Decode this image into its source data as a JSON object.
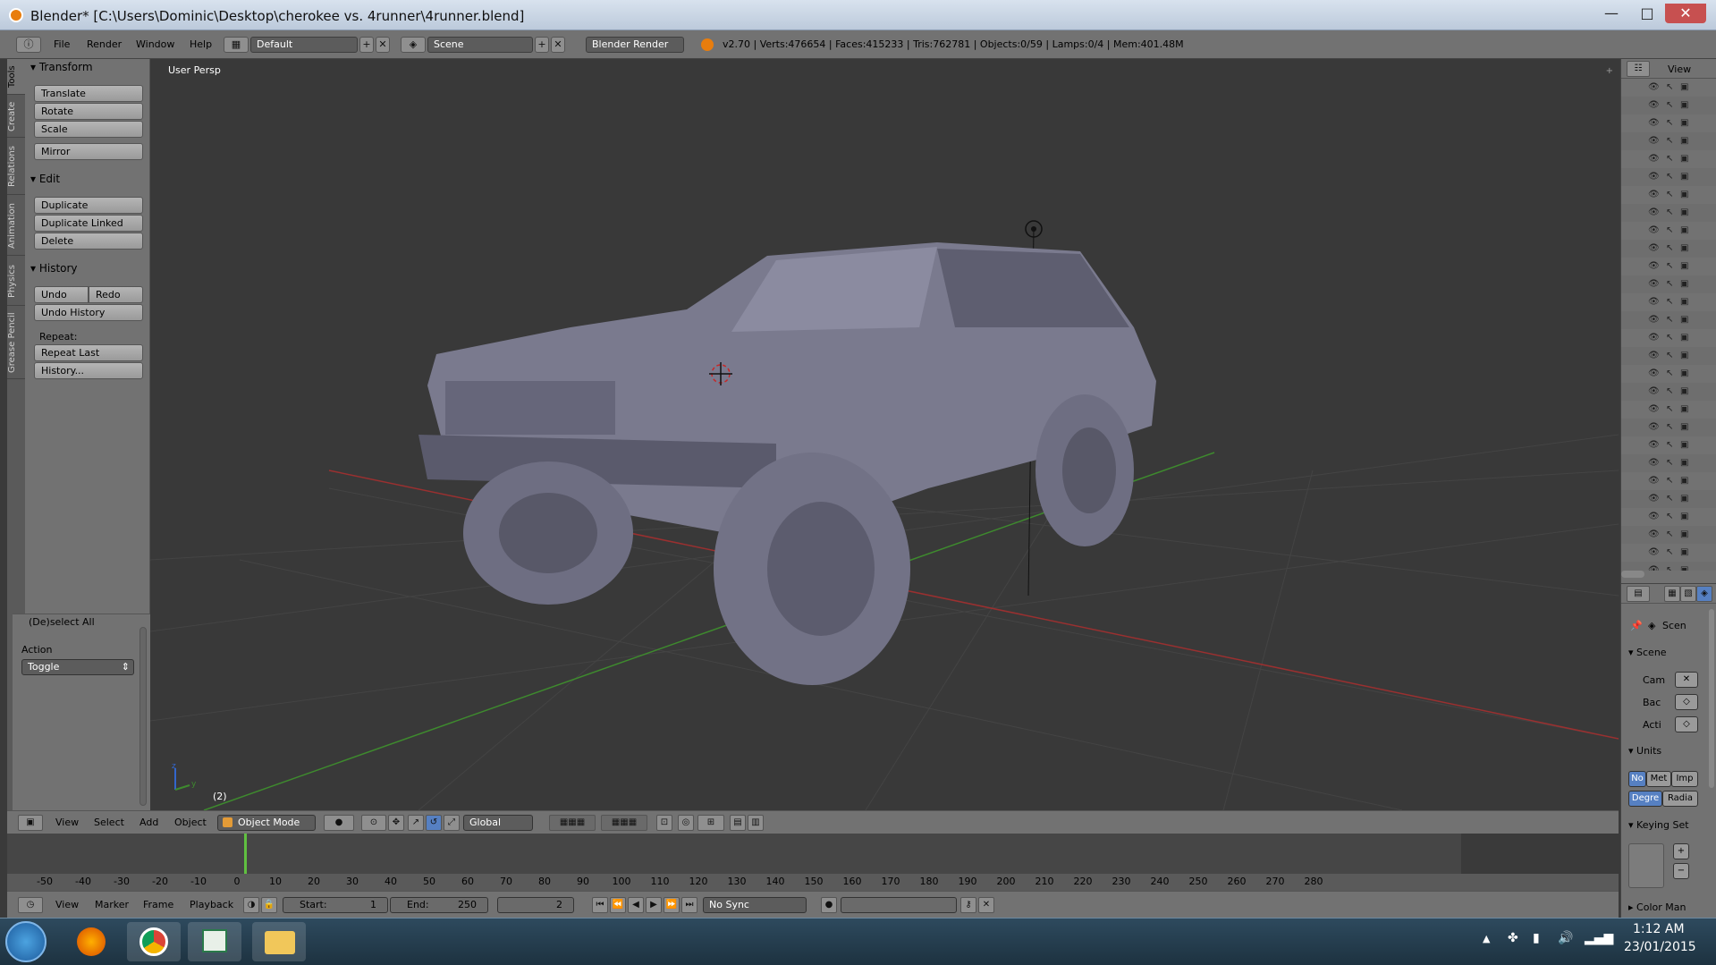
{
  "window": {
    "title": "Blender* [C:\\Users\\Dominic\\Desktop\\cherokee vs. 4runner\\4runner.blend]",
    "minimize": "—",
    "maximize": "□",
    "close": "✕"
  },
  "infobar": {
    "menus": [
      "File",
      "Render",
      "Window",
      "Help"
    ],
    "layout": "Default",
    "scene": "Scene",
    "engine": "Blender Render",
    "stats": "v2.70 | Verts:476654 | Faces:415233 | Tris:762781 | Objects:0/59 | Lamps:0/4 | Mem:401.48M"
  },
  "left_tabs": [
    "Tools",
    "Create",
    "Relations",
    "Animation",
    "Physics",
    "Grease Pencil"
  ],
  "toolshelf": {
    "transform": {
      "header": "Transform",
      "buttons": [
        "Translate",
        "Rotate",
        "Scale",
        "Mirror"
      ]
    },
    "edit": {
      "header": "Edit",
      "buttons": [
        "Duplicate",
        "Duplicate Linked",
        "Delete"
      ]
    },
    "history": {
      "header": "History",
      "undo": "Undo",
      "redo": "Redo",
      "undo_history": "Undo History",
      "repeat_label": "Repeat:",
      "repeat_last": "Repeat Last",
      "history": "History..."
    },
    "operator": {
      "header": "(De)select All",
      "action_label": "Action",
      "action_value": "Toggle"
    }
  },
  "viewport": {
    "label": "User Persp",
    "frame_indicator": "(2)",
    "axis_z": "z",
    "axis_y": "y"
  },
  "view_header": {
    "menus": [
      "View",
      "Select",
      "Add",
      "Object"
    ],
    "mode": "Object Mode",
    "orientation": "Global"
  },
  "timeline": {
    "ticks": [
      -50,
      -40,
      -30,
      -20,
      -10,
      0,
      10,
      20,
      30,
      40,
      50,
      60,
      70,
      80,
      90,
      100,
      110,
      120,
      130,
      140,
      150,
      160,
      170,
      180,
      190,
      200,
      210,
      220,
      230,
      240,
      250,
      260,
      270,
      280
    ],
    "current_frame_value": 2,
    "end_frame_value": 250
  },
  "timeline_header": {
    "menus": [
      "View",
      "Marker",
      "Frame",
      "Playback"
    ],
    "start": "Start:",
    "start_value": "1",
    "end": "End:",
    "end_value": "250",
    "current": "2",
    "sync": "No Sync"
  },
  "outliner": {
    "header": "View",
    "rows": 28
  },
  "properties": {
    "context": "Scen",
    "scene_header": "Scene",
    "cam": "Cam",
    "bac": "Bac",
    "acti": "Acti",
    "units_header": "Units",
    "unit_none": "No",
    "unit_metric": "Met",
    "unit_imperial": "Imp",
    "deg": "Degre",
    "rad": "Radia",
    "keying_header": "Keying Set",
    "color_header": "Color Man"
  },
  "taskbar": {
    "time": "1:12 AM",
    "date": "23/01/2015"
  },
  "colors": {
    "panel": "#727272",
    "viewport": "#393939",
    "active_blue": "#5680c2",
    "frame_line": "#60c040",
    "x_axis": "#9a3030",
    "y_axis": "#3e8a2e"
  }
}
